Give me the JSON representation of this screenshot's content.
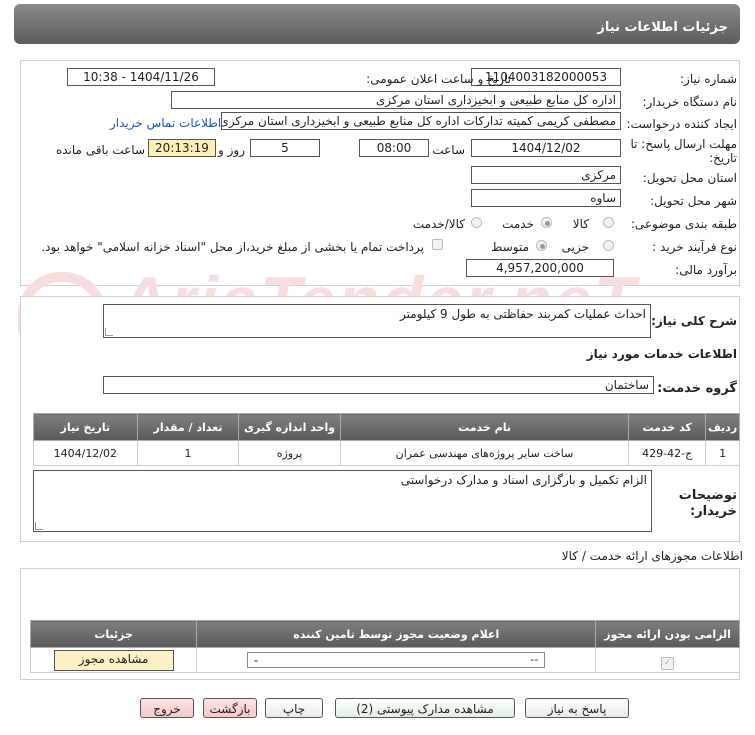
{
  "header": {
    "title": "جزئیات اطلاعات نیاز"
  },
  "watermark": {
    "text": "AriaTender.neT"
  },
  "fields": {
    "need_number_label": "شماره نیاز:",
    "need_number": "1104003182000053",
    "announce_label": "تاریخ و ساعت اعلان عمومی:",
    "announce_value": "1404/11/26 - 10:38",
    "buyer_label": "نام دستگاه خریدار:",
    "buyer_value": "اداره کل منابع طبیعی و ابخیزداری استان مرکزی",
    "creator_label": "ایجاد کننده درخواست:",
    "creator_value": "مصطفی کریمی کمیته تدارکات اداره کل منابع طبیعی و ابخیزداری استان مرکزی",
    "contact_link": "اطلاعات تماس خریدار",
    "deadline_label_1": "مهلت ارسال پاسخ: تا",
    "deadline_label_2": "تاریخ:",
    "deadline_date": "1404/12/02",
    "time_label": "ساعت",
    "deadline_time": "08:00",
    "days_value": "5",
    "days_label": "روز و",
    "remaining_time": "20:13:19",
    "remaining_label": "ساعت باقی مانده",
    "province_label": "استان محل تحویل:",
    "province_value": "مرکزی",
    "city_label": "شهر محل تحویل:",
    "city_value": "ساوه",
    "category_label": "طبقه بندی موضوعی:",
    "category_options": [
      "کالا",
      "خدمت",
      "کالا/خدمت"
    ],
    "category_selected": "خدمت",
    "process_label": "نوع فرآیند خرید :",
    "process_options": [
      "جزیی",
      "متوسط"
    ],
    "process_selected": "متوسط",
    "payment_note": "پرداخت تمام یا بخشی از مبلغ خرید،از محل \"اسناد خزانه اسلامی\" خواهد بود.",
    "budget_label": "برآورد مالی:",
    "budget_value": "4,957,200,000"
  },
  "description": {
    "label": "شرح کلی نیاز:",
    "value": "احداث عملیات کمربند حفاظتی به طول 9 کیلومتر"
  },
  "services": {
    "section_title": "اطلاعات خدمات مورد نیاز",
    "group_label": "گروه خدمت:",
    "group_value": "ساختمان",
    "columns": [
      "ردیف",
      "کد خدمت",
      "نام خدمت",
      "واحد اندازه گیری",
      "تعداد / مقدار",
      "تاریخ نیاز"
    ],
    "rows": [
      [
        "1",
        "ج-42-429",
        "ساخت سایر پروژه‌های مهندسی عمران",
        "پروژه",
        "1",
        "1404/12/02"
      ]
    ]
  },
  "buyer_notes": {
    "label_1": "توضیحات",
    "label_2": "خریدار:",
    "value": "الزام تکمیل و بارگزاری اسناد و مدارک درخواستی"
  },
  "permits": {
    "section_title": "اطلاعات مجوزهای ارائه خدمت / کالا",
    "columns": [
      "الزامی بودن ارائه مجوز",
      "اعلام وضعیت مجوز توسط تامین کننده",
      "جزئیات"
    ],
    "select_value": "--",
    "view_button": "مشاهده مجوز"
  },
  "buttons": {
    "reply": "پاسخ به نیاز",
    "attachments": "مشاهده مدارک پیوستی (2)",
    "print": "چاپ",
    "back": "بازگشت",
    "exit": "خروج"
  }
}
